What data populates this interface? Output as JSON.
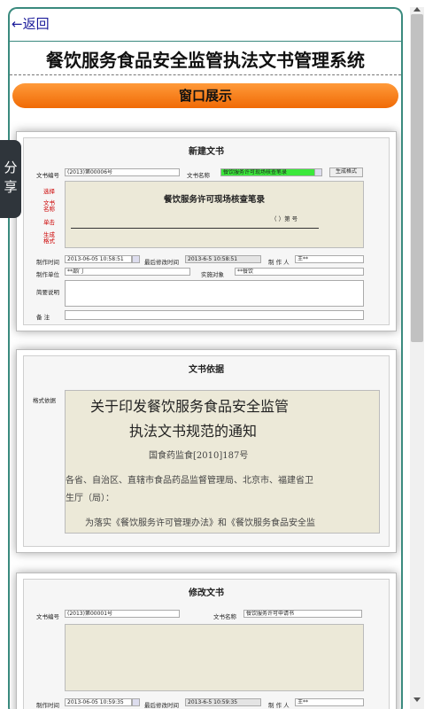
{
  "nav": {
    "back_label": "←返回"
  },
  "page": {
    "title": "餐饮服务食品安全监管执法文书管理系统"
  },
  "section": {
    "label": "窗口展示"
  },
  "share": {
    "label": "分享"
  },
  "panel1": {
    "title": "新建文书",
    "doc_no_label": "文书编号",
    "doc_no_value": "(2013)第00006号",
    "doc_name_label": "文书名称",
    "doc_name_value": "餐饮服务许可现场核查笔录",
    "generate_btn": "生成格式",
    "side1": "选择",
    "side2": "文书",
    "side3": "名称",
    "side4": "单击",
    "side5": "生成",
    "side6": "格式",
    "doc_heading": "餐饮服务许可现场核查笔录",
    "doc_number": "（    ）第       号",
    "made_time_label": "制作时间",
    "made_time_value": "2013-06-05 10:58:51",
    "mod_time_label": "最后修改时间",
    "mod_time_value": "2013-6-5 10:58:51",
    "maker_label": "制 作 人",
    "maker_value": "王**",
    "unit_label": "制作单位",
    "unit_value": "**部门",
    "target_label": "实施对象",
    "target_value": "**餐饮",
    "desc_label": "简要说明",
    "note_label": "备    注"
  },
  "panel2": {
    "title": "文书依据",
    "basis_label": "格式依据",
    "heading1": "关于印发餐饮服务食品安全监管",
    "heading2": "执法文书规范的通知",
    "ref": "国食药监食[2010]187号",
    "p1": "各省、自治区、直辖市食品药品监督管理局、北京市、福建省卫",
    "p2": "生厅（局）：",
    "p3": "为落实《餐饮服务许可管理办法》和《餐饮服务食品安全监"
  },
  "panel3": {
    "title": "修改文书",
    "doc_no_label": "文书编号",
    "doc_no_value": "(2013)第00001号",
    "doc_name_label": "文书名称",
    "doc_name_value": "餐饮服务许可申请书",
    "made_time_label": "制作时间",
    "made_time_value": "2013-06-05 10:59:35",
    "mod_time_label": "最后修改时间",
    "mod_time_value": "2013-6-5 10:59:35",
    "maker_label": "制 作 人",
    "maker_value": "王**"
  }
}
